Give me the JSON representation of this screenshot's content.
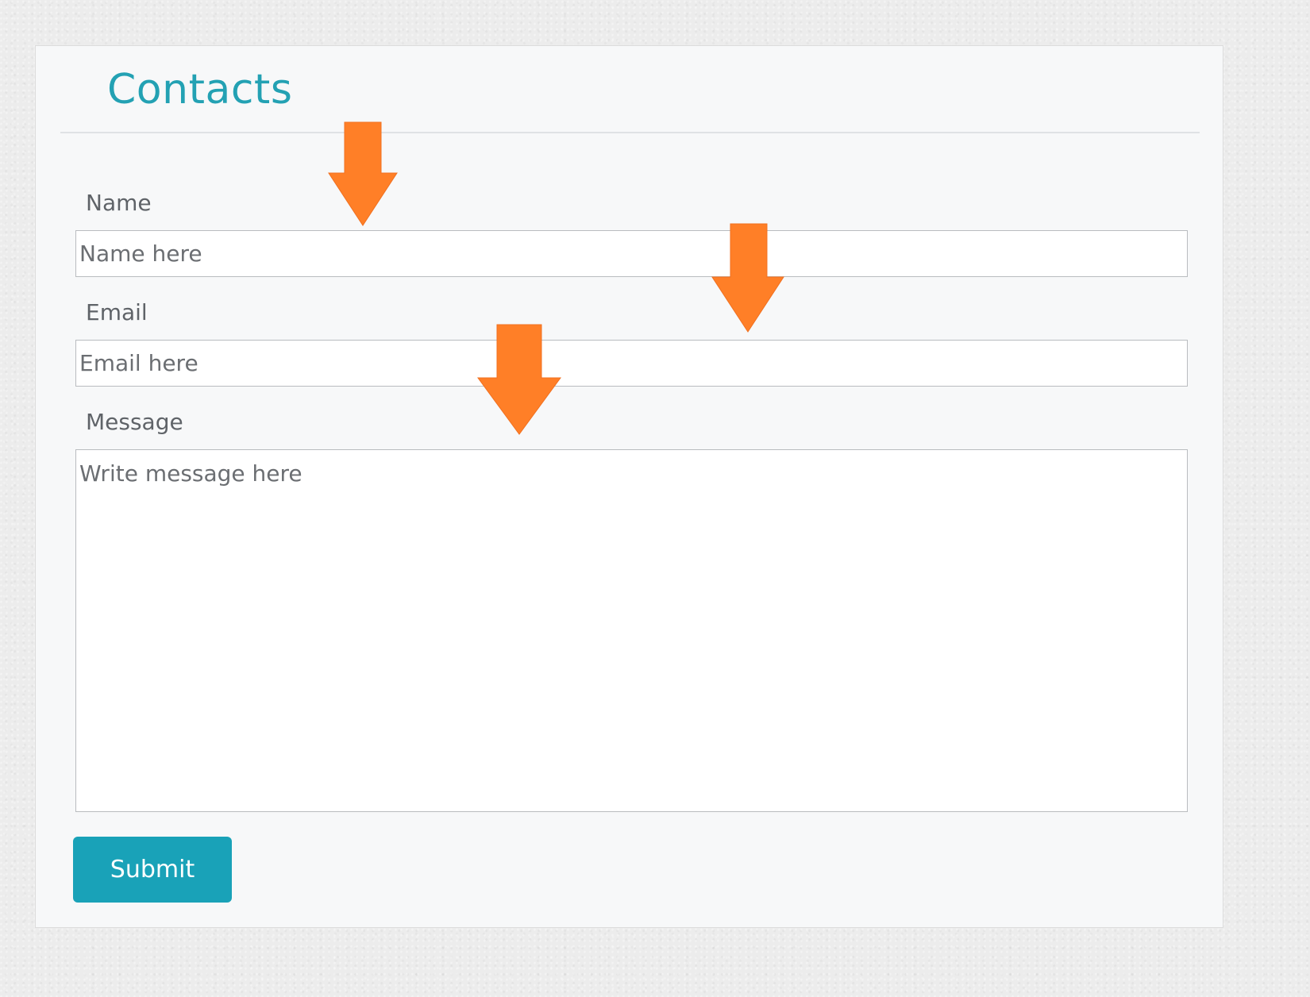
{
  "form": {
    "title": "Contacts",
    "name": {
      "label": "Name",
      "placeholder": "Name here"
    },
    "email": {
      "label": "Email",
      "placeholder": "Email here"
    },
    "message": {
      "label": "Message",
      "placeholder": "Write message here"
    },
    "submit_label": "Submit"
  },
  "colors": {
    "accent": "#19a2b8",
    "title": "#23a1b3",
    "annotation_arrow": "#ff7f27"
  },
  "annotations": [
    {
      "icon": "down-arrow-icon",
      "points_to": "name-field"
    },
    {
      "icon": "down-arrow-icon",
      "points_to": "email-field"
    },
    {
      "icon": "down-arrow-icon",
      "points_to": "message-field"
    }
  ]
}
